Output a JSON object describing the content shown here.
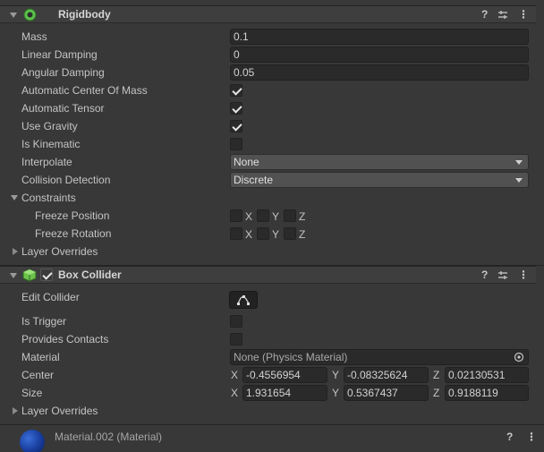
{
  "rigidbody": {
    "title": "Rigidbody",
    "properties": {
      "mass_label": "Mass",
      "mass_value": "0.1",
      "linear_damping_label": "Linear Damping",
      "linear_damping_value": "0",
      "angular_damping_label": "Angular Damping",
      "angular_damping_value": "0.05",
      "auto_com_label": "Automatic Center Of Mass",
      "auto_com_checked": true,
      "auto_tensor_label": "Automatic Tensor",
      "auto_tensor_checked": true,
      "use_gravity_label": "Use Gravity",
      "use_gravity_checked": true,
      "is_kinematic_label": "Is Kinematic",
      "is_kinematic_checked": false,
      "interpolate_label": "Interpolate",
      "interpolate_value": "None",
      "collision_label": "Collision Detection",
      "collision_value": "Discrete"
    },
    "constraints": {
      "label": "Constraints",
      "freeze_position_label": "Freeze Position",
      "freeze_rotation_label": "Freeze Rotation",
      "axis_x": "X",
      "axis_y": "Y",
      "axis_z": "Z"
    },
    "layer_overrides_label": "Layer Overrides"
  },
  "box_collider": {
    "title": "Box Collider",
    "enabled": true,
    "edit_collider_label": "Edit Collider",
    "is_trigger_label": "Is Trigger",
    "is_trigger_checked": false,
    "provides_contacts_label": "Provides Contacts",
    "provides_contacts_checked": false,
    "material_label": "Material",
    "material_value": "None (Physics Material)",
    "center_label": "Center",
    "center": {
      "x_label": "X",
      "x": "-0.4556954",
      "y_label": "Y",
      "y": "-0.08325624",
      "z_label": "Z",
      "z": "0.02130531"
    },
    "size_label": "Size",
    "size": {
      "x_label": "X",
      "x": "1.931654",
      "y_label": "Y",
      "y": "0.5367437",
      "z_label": "Z",
      "z": "0.9188119"
    },
    "layer_overrides_label": "Layer Overrides"
  },
  "material_component": {
    "title": "Material.002 (Material)"
  },
  "icons": {
    "help": "?",
    "more": "⋮"
  }
}
